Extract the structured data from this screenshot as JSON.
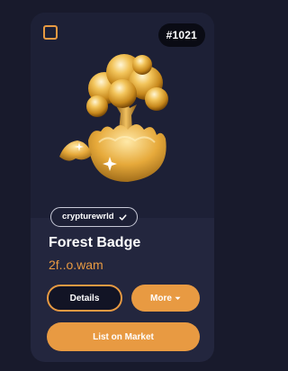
{
  "card": {
    "id_badge": "#1021",
    "creator": "crypturewrld",
    "title": "Forest Badge",
    "owner": "2f..o.wam"
  },
  "buttons": {
    "details_label": "Details",
    "more_label": "More",
    "market_label": "List on Market"
  },
  "icons": {
    "checkbox": "checkbox-icon",
    "verified": "check-icon",
    "more_caret": "caret-down-icon",
    "art": "golden-tree-egg-icon"
  },
  "colors": {
    "background": "#181a2c",
    "card": "#23263e",
    "accent": "#e89a42",
    "badge_bg": "#0a0b14",
    "text": "#ffffff"
  }
}
